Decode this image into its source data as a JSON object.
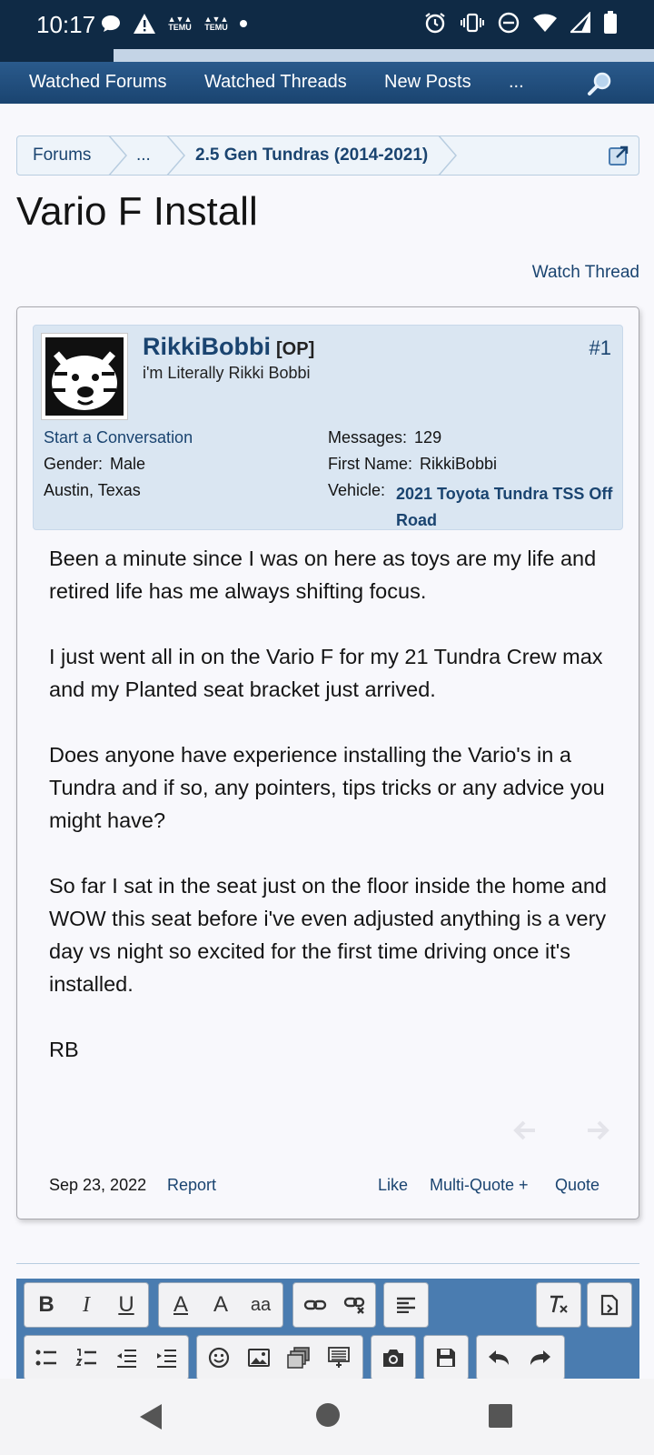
{
  "status_bar": {
    "time": "10:17",
    "temu_label": "TEMU"
  },
  "nav": {
    "items": [
      "Watched Forums",
      "Watched Threads",
      "New Posts",
      "..."
    ]
  },
  "breadcrumb": {
    "items": [
      "Forums",
      "...",
      "2.5 Gen Tundras (2014-2021)"
    ]
  },
  "page": {
    "title": "Vario F Install",
    "watch_label": "Watch Thread"
  },
  "post": {
    "username": "RikkiBobbi",
    "op_tag": "[OP]",
    "user_title": "i'm Literally Rikki Bobbi",
    "post_number": "#1",
    "start_conversation": "Start a Conversation",
    "gender_label": "Gender:",
    "gender_value": "Male",
    "location": "Austin, Texas",
    "messages_label": "Messages:",
    "messages_value": "129",
    "first_name_label": "First Name:",
    "first_name_value": "RikkiBobbi",
    "vehicle_label": "Vehicle:",
    "vehicle_value": "2021 Toyota Tundra TSS Off Road",
    "body": [
      "Been a minute since I was on here as toys are my life and retired life has me always shifting focus.",
      "I just went all in on the Vario F for my 21 Tundra Crew max and my Planted seat bracket just arrived.",
      "Does anyone have experience installing the Vario's in a Tundra and if so, any pointers, tips tricks or any advice you might have?",
      "So far I sat in the seat just on the floor inside the home and WOW this seat before i've even adjusted anything is a very day vs night so excited for the first time driving once it's installed.",
      "RB"
    ],
    "date": "Sep 23, 2022",
    "report": "Report",
    "like": "Like",
    "multi_quote": "Multi-Quote +",
    "quote": "Quote"
  },
  "editor": {
    "bold": "B",
    "italic": "I",
    "underline": "U",
    "text_color": "A",
    "font_size": "A",
    "font_family": "aa"
  },
  "colors": {
    "nav_bg": "#1a4470",
    "status_bg": "#0f2a45",
    "link": "#1a4470",
    "userbox_bg": "#dae6f2"
  }
}
